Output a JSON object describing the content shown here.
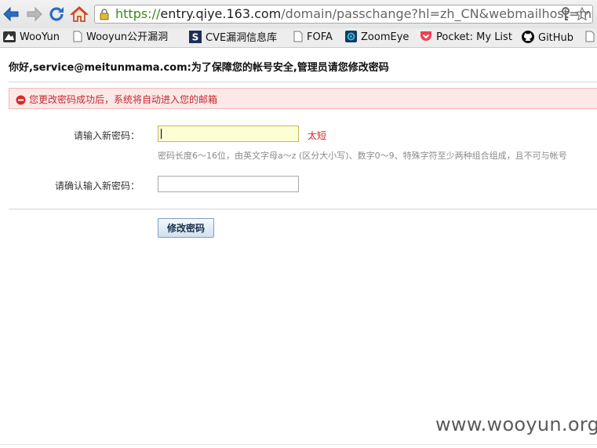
{
  "browser": {
    "url_scheme": "https://",
    "url_host": "entry.qiye.163.com",
    "url_path": "/domain/passchange?hl=zh_CN&webmailhost=mail.m",
    "bookmarks": [
      {
        "label": "WooYun",
        "icon": "wooyun-favicon"
      },
      {
        "label": "Wooyun公开漏洞",
        "icon": "page-icon"
      },
      {
        "label": "CVE漏洞信息库",
        "icon": "cve-favicon"
      },
      {
        "label": "FOFA",
        "icon": "page-icon"
      },
      {
        "label": "ZoomEye",
        "icon": "zoomeye-favicon"
      },
      {
        "label": "Pocket: My List",
        "icon": "pocket-icon"
      },
      {
        "label": "GitHub",
        "icon": "github-icon"
      }
    ]
  },
  "page": {
    "headline": "你好,service@meitunmama.com:为了保障您的帐号安全,管理员请您修改密码",
    "alert": "您更改密码成功后，系统将自动进入您的邮箱",
    "new_password_label": "请输入新密码：",
    "strength_message": "太短",
    "hint": "密码长度6～16位，由英文字母a～z (区分大小写)、数字0～9、特殊字符至少两种组合组成，且不可与帐号",
    "confirm_label": "请确认输入新密码：",
    "submit_label": "修改密码"
  },
  "watermark": "www.wooyun.org",
  "colors": {
    "alert_bg": "#fde8e8",
    "error_text": "#d9261c",
    "url_secure": "#3a8a16"
  }
}
